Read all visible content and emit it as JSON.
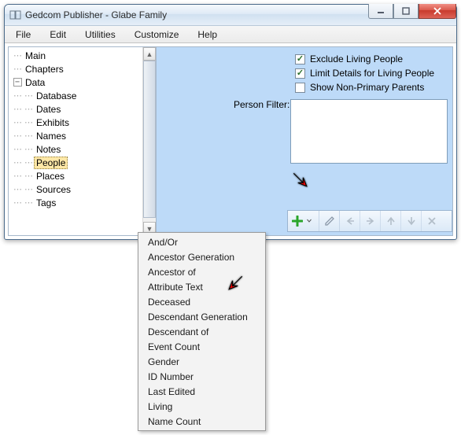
{
  "window": {
    "title": "Gedcom Publisher - Glabe Family"
  },
  "menubar": [
    "File",
    "Edit",
    "Utilities",
    "Customize",
    "Help"
  ],
  "tree": {
    "items": [
      {
        "label": "Main",
        "depth": 1,
        "exp": null
      },
      {
        "label": "Chapters",
        "depth": 1,
        "exp": null
      },
      {
        "label": "Data",
        "depth": 1,
        "exp": "open"
      },
      {
        "label": "Database",
        "depth": 2,
        "exp": null
      },
      {
        "label": "Dates",
        "depth": 2,
        "exp": null
      },
      {
        "label": "Exhibits",
        "depth": 2,
        "exp": null
      },
      {
        "label": "Names",
        "depth": 2,
        "exp": null
      },
      {
        "label": "Notes",
        "depth": 2,
        "exp": null
      },
      {
        "label": "People",
        "depth": 2,
        "exp": null,
        "selected": true
      },
      {
        "label": "Places",
        "depth": 2,
        "exp": null
      },
      {
        "label": "Sources",
        "depth": 2,
        "exp": null
      },
      {
        "label": "Tags",
        "depth": 2,
        "exp": null
      }
    ]
  },
  "checks": [
    {
      "label": "Exclude Living People",
      "checked": true
    },
    {
      "label": "Limit Details for Living People",
      "checked": true
    },
    {
      "label": "Show Non-Primary Parents",
      "checked": false
    }
  ],
  "filter_label": "Person Filter:",
  "dropdown": [
    "And/Or",
    "Ancestor Generation",
    "Ancestor of",
    "Attribute Text",
    "Deceased",
    "Descendant Generation",
    "Descendant of",
    "Event Count",
    "Gender",
    "ID Number",
    "Last Edited",
    "Living",
    "Name Count"
  ]
}
